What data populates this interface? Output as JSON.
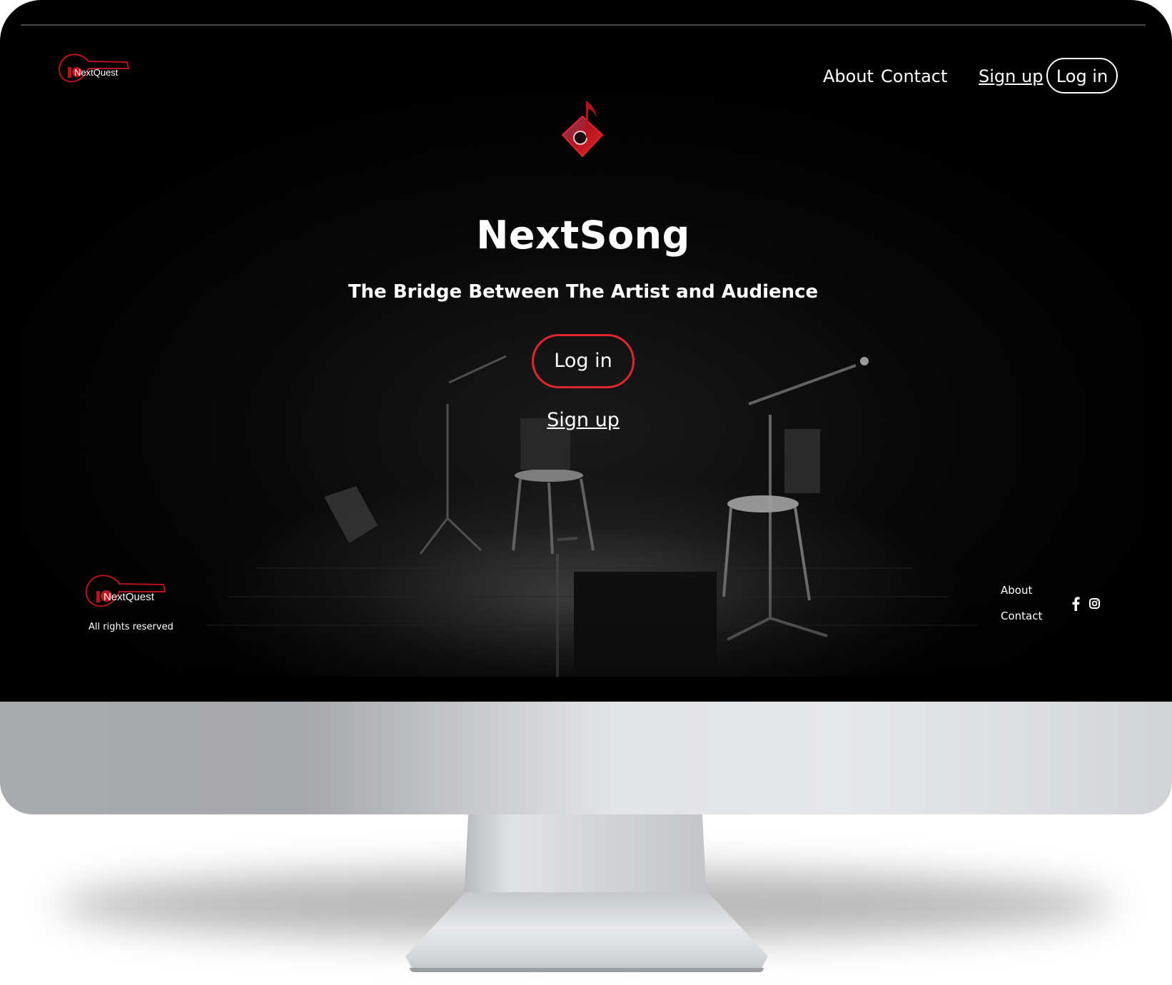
{
  "brand": {
    "logo_text": "NextQuest"
  },
  "nav": {
    "about": "About",
    "contact": "Contact",
    "signup": "Sign up",
    "login": "Log in"
  },
  "hero": {
    "title": "NextSong",
    "tagline": "The Bridge Between The Artist and Audience",
    "login_button": "Log in",
    "signup_link": "Sign up"
  },
  "footer": {
    "logo_text": "NextQuest",
    "rights": "All rights reserved",
    "about": "About",
    "contact": "Contact",
    "social_icons": [
      "facebook-icon",
      "instagram-icon"
    ]
  },
  "colors": {
    "accent": "#e2262f",
    "logo_red": "#b5141c",
    "background": "#000000",
    "text": "#ffffff"
  }
}
